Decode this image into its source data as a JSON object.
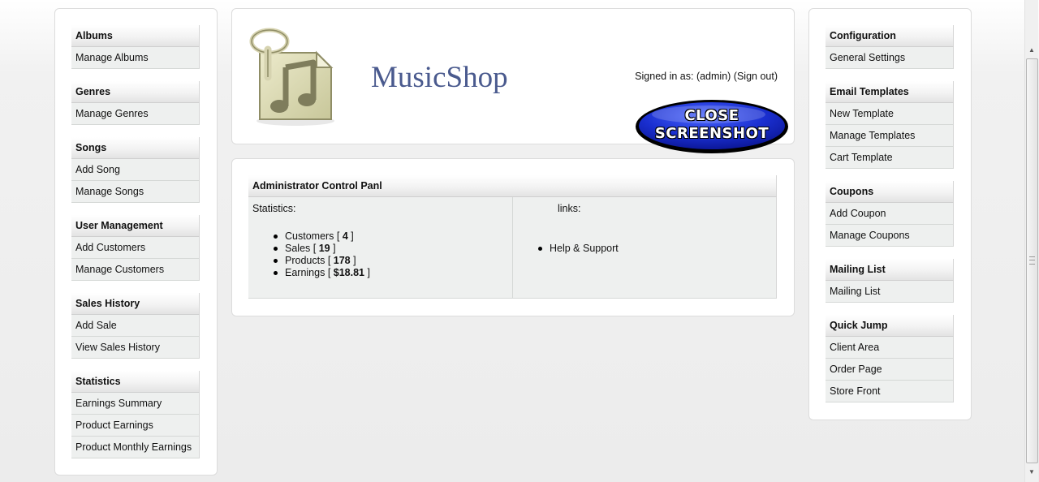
{
  "left_menu": [
    {
      "head": "Albums",
      "items": [
        "Manage Albums"
      ]
    },
    {
      "head": "Genres",
      "items": [
        "Manage Genres"
      ]
    },
    {
      "head": "Songs",
      "items": [
        "Add Song",
        "Manage Songs"
      ]
    },
    {
      "head": "User Management",
      "items": [
        "Add Customers",
        "Manage Customers"
      ]
    },
    {
      "head": "Sales History",
      "items": [
        "Add Sale",
        "View Sales History"
      ]
    },
    {
      "head": "Statistics",
      "items": [
        "Earnings Summary",
        "Product Earnings",
        "Product Monthly Earnings"
      ]
    }
  ],
  "right_menu": [
    {
      "head": "Configuration",
      "items": [
        "General Settings"
      ]
    },
    {
      "head": "Email Templates",
      "items": [
        "New Template",
        "Manage Templates",
        "Cart Template"
      ]
    },
    {
      "head": "Coupons",
      "items": [
        "Add Coupon",
        "Manage Coupons"
      ]
    },
    {
      "head": "Mailing List",
      "items": [
        "Mailing List"
      ]
    },
    {
      "head": "Quick Jump",
      "items": [
        "Client Area",
        "Order Page",
        "Store Front"
      ]
    }
  ],
  "header": {
    "site_title": "MusicShop",
    "signed_in_prefix": "Signed in as:",
    "username": "(admin)",
    "sign_out": "(Sign out)",
    "close_label_line1": "CLOSE",
    "close_label_line2": "SCREENSHOT"
  },
  "control_panel": {
    "title": "Administrator Control Panl",
    "stats_label": "Statistics:",
    "links_label": "links:",
    "stats": [
      {
        "label": "Customers",
        "value": "4"
      },
      {
        "label": "Sales",
        "value": "19"
      },
      {
        "label": "Products",
        "value": "178"
      },
      {
        "label": "Earnings",
        "value": "$18.81"
      }
    ],
    "links": [
      "Help & Support"
    ]
  },
  "colors": {
    "title_color": "#4a5a8e",
    "close_button_blue": "#1a2fd0",
    "menu_item_bg": "#eef0ef"
  },
  "icons": {
    "logo": "music-note-document-icon",
    "scroll_up": "arrow-up-icon",
    "scroll_down": "arrow-down-icon"
  }
}
